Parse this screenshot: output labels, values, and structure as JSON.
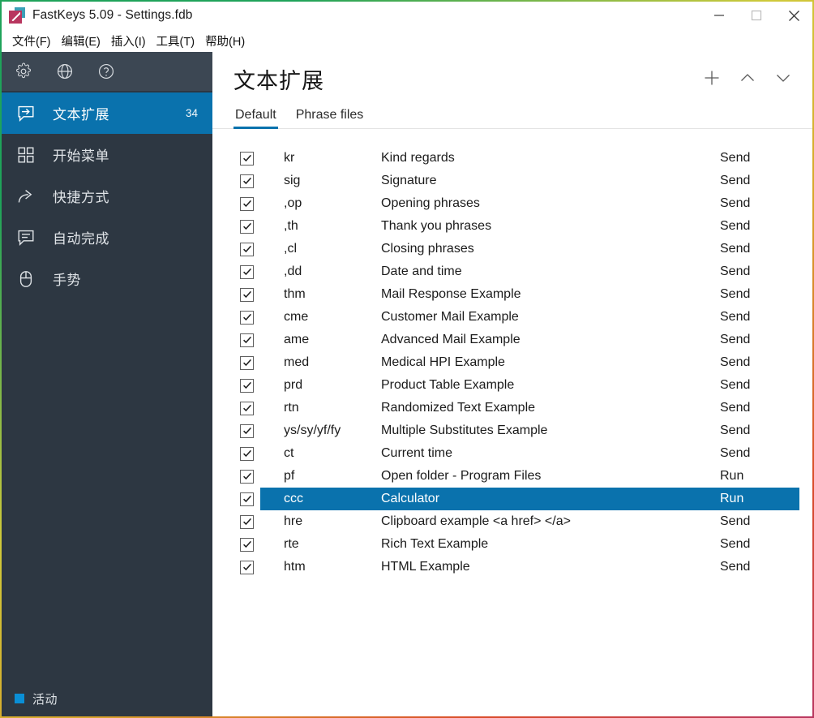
{
  "window": {
    "title": "FastKeys 5.09  - Settings.fdb",
    "app_icon": "fastkeys-logo-icon",
    "controls": [
      {
        "name": "minimize-button",
        "icon": "minimize-icon"
      },
      {
        "name": "maximize-button",
        "icon": "maximize-icon"
      },
      {
        "name": "close-button",
        "icon": "close-icon"
      }
    ]
  },
  "menubar": {
    "items": [
      {
        "label": "文件(F)",
        "name": "menu-file"
      },
      {
        "label": "编辑(E)",
        "name": "menu-edit"
      },
      {
        "label": "插入(I)",
        "name": "menu-insert"
      },
      {
        "label": "工具(T)",
        "name": "menu-tools"
      },
      {
        "label": "帮助(H)",
        "name": "menu-help"
      }
    ]
  },
  "sidebar": {
    "toolbar_icons": [
      {
        "name": "gear-icon",
        "label": "settings"
      },
      {
        "name": "globe-icon",
        "label": "language"
      },
      {
        "name": "help-icon",
        "label": "help"
      }
    ],
    "items": [
      {
        "label": "文本扩展",
        "count": "34",
        "icon": "text-expansion-icon",
        "active": true
      },
      {
        "label": "开始菜单",
        "count": "",
        "icon": "start-menu-grid-icon",
        "active": false
      },
      {
        "label": "快捷方式",
        "count": "",
        "icon": "shortcut-arrow-icon",
        "active": false
      },
      {
        "label": "自动完成",
        "count": "",
        "icon": "autocomplete-bubble-icon",
        "active": false
      },
      {
        "label": "手势",
        "count": "",
        "icon": "mouse-gesture-icon",
        "active": false
      }
    ],
    "status": {
      "label": "活动",
      "dot_color": "#0a8fd6"
    }
  },
  "main": {
    "page_title": "文本扩展",
    "header_actions": [
      {
        "name": "add-button",
        "icon": "plus-icon"
      },
      {
        "name": "move-up-button",
        "icon": "chevron-up-icon"
      },
      {
        "name": "move-down-button",
        "icon": "chevron-down-icon"
      }
    ],
    "tabs": [
      {
        "label": "Default",
        "active": true
      },
      {
        "label": "Phrase files",
        "active": false
      }
    ],
    "rows": [
      {
        "checked": true,
        "abbr": "kr",
        "phrase": "Kind regards",
        "action": "Send",
        "selected": false
      },
      {
        "checked": true,
        "abbr": "sig",
        "phrase": "Signature",
        "action": "Send",
        "selected": false
      },
      {
        "checked": true,
        "abbr": ",op",
        "phrase": "Opening phrases",
        "action": "Send",
        "selected": false
      },
      {
        "checked": true,
        "abbr": ",th",
        "phrase": "Thank you phrases",
        "action": "Send",
        "selected": false
      },
      {
        "checked": true,
        "abbr": ",cl",
        "phrase": "Closing phrases",
        "action": "Send",
        "selected": false
      },
      {
        "checked": true,
        "abbr": ",dd",
        "phrase": "Date and time",
        "action": "Send",
        "selected": false
      },
      {
        "checked": true,
        "abbr": "thm",
        "phrase": "Mail Response Example",
        "action": "Send",
        "selected": false
      },
      {
        "checked": true,
        "abbr": "cme",
        "phrase": "Customer Mail Example",
        "action": "Send",
        "selected": false
      },
      {
        "checked": true,
        "abbr": "ame",
        "phrase": "Advanced Mail Example",
        "action": "Send",
        "selected": false
      },
      {
        "checked": true,
        "abbr": "med",
        "phrase": "Medical HPI Example",
        "action": "Send",
        "selected": false
      },
      {
        "checked": true,
        "abbr": "prd",
        "phrase": "Product Table Example",
        "action": "Send",
        "selected": false
      },
      {
        "checked": true,
        "abbr": "rtn",
        "phrase": "Randomized Text Example",
        "action": "Send",
        "selected": false
      },
      {
        "checked": true,
        "abbr": "ys/sy/yf/fy",
        "phrase": "Multiple Substitutes Example",
        "action": "Send",
        "selected": false
      },
      {
        "checked": true,
        "abbr": "ct",
        "phrase": "Current time",
        "action": "Send",
        "selected": false
      },
      {
        "checked": true,
        "abbr": "pf",
        "phrase": "Open folder - Program Files",
        "action": "Run",
        "selected": false
      },
      {
        "checked": true,
        "abbr": "ccc",
        "phrase": "Calculator",
        "action": "Run",
        "selected": true
      },
      {
        "checked": true,
        "abbr": "hre",
        "phrase": "Clipboard example <a href> </a>",
        "action": "Send",
        "selected": false
      },
      {
        "checked": true,
        "abbr": "rte",
        "phrase": "Rich Text Example",
        "action": "Send",
        "selected": false
      },
      {
        "checked": true,
        "abbr": "htm",
        "phrase": "HTML Example",
        "action": "Send",
        "selected": false
      }
    ]
  },
  "colors": {
    "accent": "#0a72ad",
    "sidebar_bg": "#2d3742",
    "sidebar_toolbar_bg": "#3c4753"
  }
}
